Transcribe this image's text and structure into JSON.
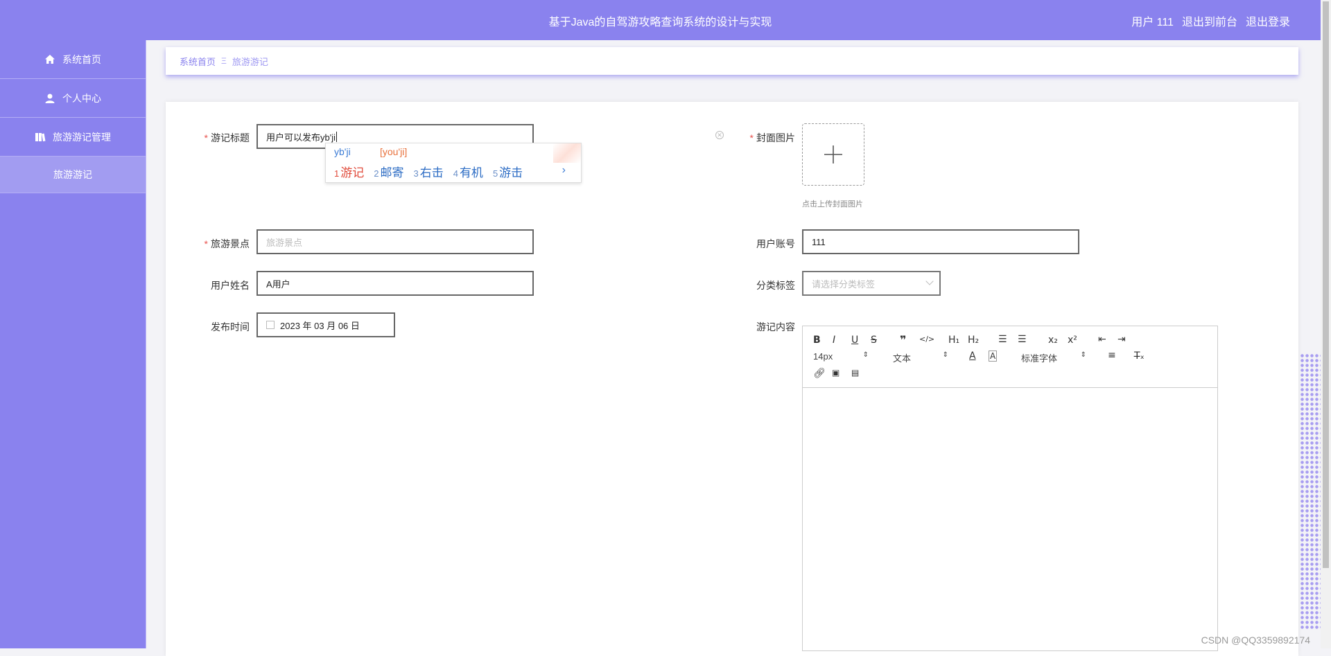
{
  "header": {
    "title": "基于Java的自驾游攻略查询系统的设计与实现",
    "user": "用户 111",
    "back_front": "退出到前台",
    "logout": "退出登录"
  },
  "sidebar": {
    "items": [
      {
        "label": "系统首页",
        "icon": "home-icon"
      },
      {
        "label": "个人中心",
        "icon": "user-icon"
      },
      {
        "label": "旅游游记管理",
        "icon": "book-icon"
      },
      {
        "label": "旅游游记"
      }
    ]
  },
  "breadcrumb": {
    "home": "系统首页",
    "separator": "Ξ",
    "current": "旅游游记"
  },
  "form": {
    "title_label": "游记标题",
    "title_value": "用户可以发布yb'ji",
    "cover_label": "封面图片",
    "cover_tip": "点击上传封面图片",
    "spot_label": "旅游景点",
    "spot_placeholder": "旅游景点",
    "account_label": "用户账号",
    "account_value": "111",
    "name_label": "用户姓名",
    "name_value": "A用户",
    "tag_label": "分类标签",
    "tag_placeholder": "请选择分类标签",
    "time_label": "发布时间",
    "time_value": "2023 年 03 月 06 日",
    "content_label": "游记内容"
  },
  "ime": {
    "pinyin": "yb'ji",
    "hint": "[you'ji]",
    "candidates": [
      {
        "n": "1",
        "text": "游记"
      },
      {
        "n": "2",
        "text": "邮寄"
      },
      {
        "n": "3",
        "text": "右击"
      },
      {
        "n": "4",
        "text": "有机"
      },
      {
        "n": "5",
        "text": "游击"
      }
    ],
    "next": "›"
  },
  "editor": {
    "font_size": "14px",
    "text_type": "文本",
    "font_family": "标准字体"
  },
  "watermark": "CSDN @QQ3359892174"
}
